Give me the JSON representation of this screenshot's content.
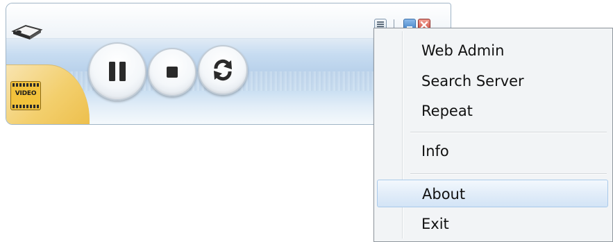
{
  "player": {
    "video_badge_label": "VIDEO",
    "controls": {
      "pause_icon": "pause-icon",
      "stop_icon": "stop-icon",
      "repeat_icon": "repeat-icon"
    },
    "window_buttons": [
      "menu-icon",
      "minimize-icon",
      "close-icon"
    ],
    "colors": {
      "accent_blue": "#b7d0ea",
      "badge_yellow": "#f2c23c",
      "close_red": "#cf4a3c"
    }
  },
  "context_menu": {
    "items": [
      {
        "label": "Web Admin"
      },
      {
        "label": "Search Server"
      },
      {
        "label": "Repeat"
      },
      {
        "label": "Info"
      },
      {
        "label": "About",
        "highlighted": true
      },
      {
        "label": "Exit"
      }
    ]
  }
}
